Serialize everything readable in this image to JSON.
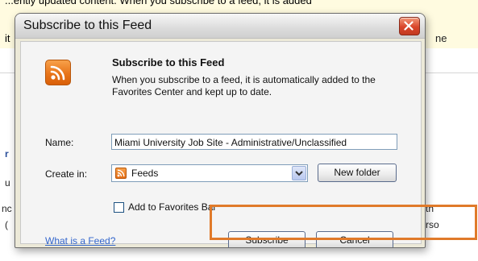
{
  "background": {
    "top_line": "...ently updated content. When you subscribe to a feed, it is added",
    "left_fragment": "it",
    "right_fragment": "ne",
    "frag_r": "r",
    "frag_u": "u",
    "frag_nc": "nc",
    "frag_paren": "(",
    "frag_th": "th",
    "frag_rso": "rso"
  },
  "dialog": {
    "title": "Subscribe to this Feed",
    "heading": "Subscribe to this Feed",
    "description": "When you subscribe to a feed, it is automatically added to the Favorites Center and kept up to date.",
    "name_label": "Name:",
    "name_value": "Miami University Job Site - Administrative/Unclassified",
    "create_in_label": "Create in:",
    "create_in_value": "Feeds",
    "new_folder_label": "New folder",
    "add_to_favorites_label": "Add to Favorites Bar",
    "add_to_favorites_checked": false,
    "what_is_feed_link": "What is a Feed?",
    "subscribe_label": "Subscribe",
    "cancel_label": "Cancel"
  },
  "icons": {
    "close": "close-icon",
    "rss_large": "rss-feed-icon",
    "rss_small": "rss-feed-icon",
    "dropdown": "chevron-down-icon"
  },
  "colors": {
    "highlight": "#e07a2a",
    "rss_orange": "#e8751a",
    "close_red": "#d9452a",
    "link_blue": "#3366cc"
  }
}
